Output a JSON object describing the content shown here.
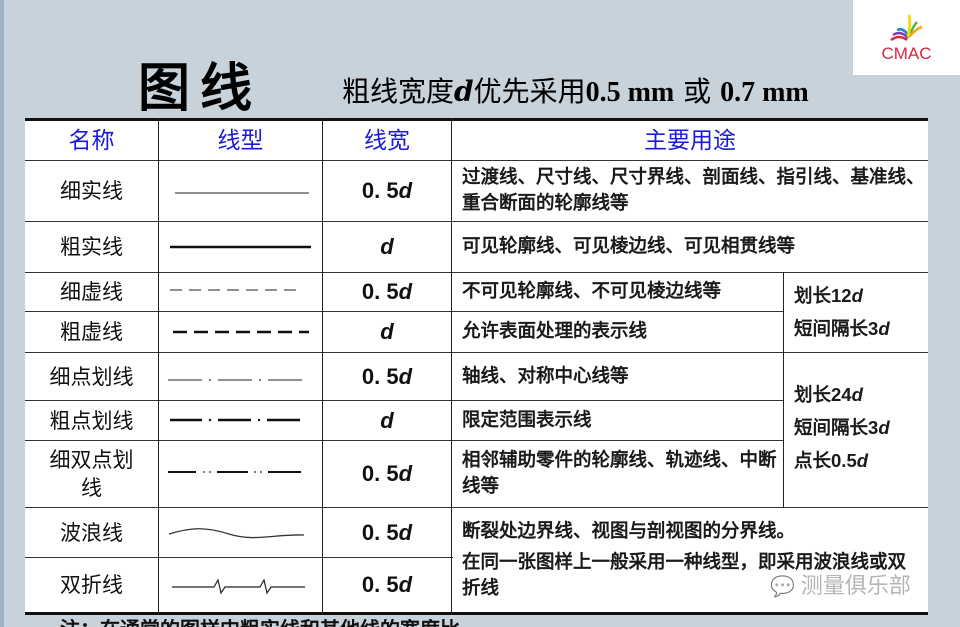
{
  "title": {
    "main": "图线",
    "sub_prefix": "粗线宽度",
    "sub_var": "d",
    "sub_middle": "优先采用",
    "sub_value1": "0.5 mm",
    "sub_or": " 或 ",
    "sub_value2": "0.7 mm"
  },
  "logo": {
    "text": "CMAC",
    "colors": [
      "#d8263a",
      "#f2a51a",
      "#f5d90f",
      "#4bb84a",
      "#2a7fd1",
      "#7b3fb8"
    ]
  },
  "table": {
    "headers": [
      "名称",
      "线型",
      "线宽",
      "主要用途"
    ],
    "rows": [
      {
        "name": "细实线",
        "line_type": "thin-solid",
        "width_num": "0. 5 ",
        "width_var": "d",
        "use": "过渡线、尺寸线、尺寸界线、剖面线、指引线、基准线、重合断面的轮廓线等"
      },
      {
        "name": "粗实线",
        "line_type": "thick-solid",
        "width_num": "",
        "width_var": "d",
        "use": "可见轮廓线、可见棱边线、可见相贯线等"
      },
      {
        "name": "细虚线",
        "line_type": "thin-dashed",
        "width_num": "0. 5 ",
        "width_var": "d",
        "use": "不可见轮廓线、不可见棱边线等"
      },
      {
        "name": "粗虚线",
        "line_type": "thick-dashed",
        "width_num": "",
        "width_var": "d",
        "use": "允许表面处理的表示线"
      },
      {
        "name": "细点划线",
        "line_type": "thin-dash-dot",
        "width_num": "0. 5 ",
        "width_var": "d",
        "use": "轴线、对称中心线等"
      },
      {
        "name": "粗点划线",
        "line_type": "thick-dash-dot",
        "width_num": "",
        "width_var": "d",
        "use": "限定范围表示线"
      },
      {
        "name": "细双点划线",
        "line_type": "thin-dash-double-dot",
        "width_num": "0. 5 ",
        "width_var": "d",
        "use": "相邻辅助零件的轮廓线、轨迹线、中断线等"
      },
      {
        "name": "波浪线",
        "line_type": "wavy",
        "width_num": "0. 5 ",
        "width_var": "d"
      },
      {
        "name": "双折线",
        "line_type": "zigzag",
        "width_num": "0. 5 ",
        "width_var": "d"
      }
    ],
    "dashed_note": {
      "line1_label": "划长",
      "line1_val": "12",
      "line2_label": "短间隔长",
      "line2_val": "3",
      "var": "d"
    },
    "dashdot_note": {
      "line1_label": "划长",
      "line1_val": "24",
      "line2_label": "短间隔长",
      "line2_val": "3",
      "line3_label": "点长",
      "line3_val": "0.5",
      "var": "d"
    },
    "break_lines_use": {
      "line1": "断裂处边界线、视图与剖视图的分界线。",
      "line2": "在同一张图样上一般采用一种线型，即采用波浪线或双折线"
    }
  },
  "watermark": {
    "icon": "wechat-icon",
    "text": "测量俱乐部"
  },
  "footer_cut_text": "注：在通常的图样中粗实线和其他线的宽度比"
}
